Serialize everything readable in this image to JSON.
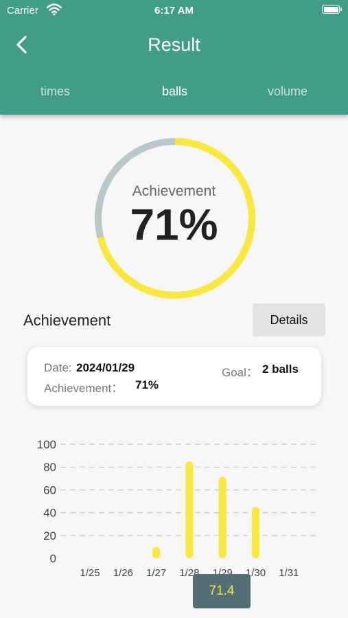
{
  "status_bar": {
    "carrier": "Carrier",
    "time": "6:17 AM"
  },
  "header": {
    "title": "Result",
    "tabs": [
      {
        "label": "times",
        "active": false
      },
      {
        "label": "balls",
        "active": true
      },
      {
        "label": "volume",
        "active": false
      }
    ]
  },
  "gauge": {
    "label": "Achievement",
    "value_text": "71%",
    "fraction": 0.71,
    "colors": {
      "fill": "#fbe83e",
      "track": "#b9c8c8"
    }
  },
  "achievement": {
    "title": "Achievement",
    "details_label": "Details",
    "date_label": "Date:",
    "date_value": "2024/01/29",
    "goal_label": "Goal：",
    "goal_value": "2 balls",
    "achievement_label": "Achievement：",
    "achievement_value": "71%"
  },
  "colors": {
    "header": "#419c88",
    "bar": "#fbe83e",
    "tooltip_bg": "#546e76"
  },
  "chart_data": {
    "type": "bar",
    "categories": [
      "1/25",
      "1/26",
      "1/27",
      "1/28",
      "1/29",
      "1/30",
      "1/31"
    ],
    "values": [
      0,
      0,
      10,
      85,
      71.4,
      45,
      0
    ],
    "ylim": [
      0,
      100
    ],
    "y_ticks": [
      "0",
      "20",
      "40",
      "60",
      "80",
      "100"
    ],
    "grid": true,
    "tooltip": "71.4"
  }
}
